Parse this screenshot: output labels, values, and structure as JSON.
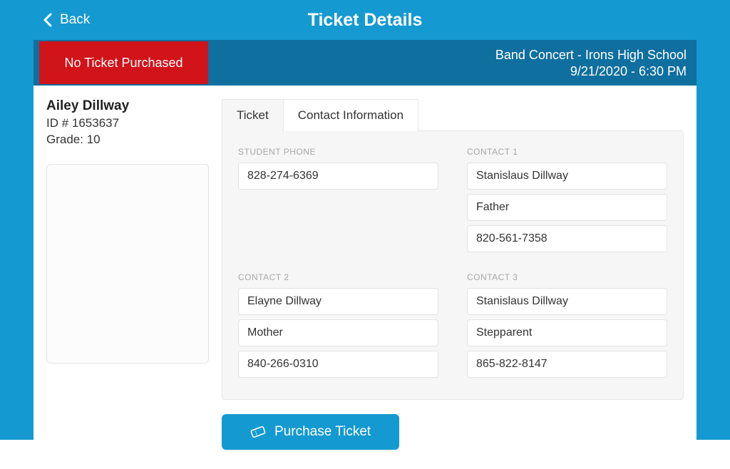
{
  "header": {
    "back_label": "Back",
    "title": "Ticket Details"
  },
  "event": {
    "status_text": "No Ticket Purchased",
    "name": "Band Concert - Irons High School",
    "datetime": "9/21/2020 - 6:30 PM"
  },
  "student": {
    "name": "Ailey Dillway",
    "id_label": "ID # 1653637",
    "grade_label": "Grade: 10"
  },
  "tabs": {
    "ticket": "Ticket",
    "contact": "Contact Information"
  },
  "labels": {
    "student_phone": "STUDENT PHONE",
    "contact1": "CONTACT 1",
    "contact2": "CONTACT 2",
    "contact3": "CONTACT 3"
  },
  "contact_info": {
    "student_phone": "828-274-6369",
    "contact1": {
      "name": "Stanislaus Dillway",
      "relation": "Father",
      "phone": "820-561-7358"
    },
    "contact2": {
      "name": "Elayne Dillway",
      "relation": "Mother",
      "phone": "840-266-0310"
    },
    "contact3": {
      "name": "Stanislaus Dillway",
      "relation": "Stepparent",
      "phone": "865-822-8147"
    }
  },
  "actions": {
    "purchase_label": "Purchase Ticket"
  }
}
